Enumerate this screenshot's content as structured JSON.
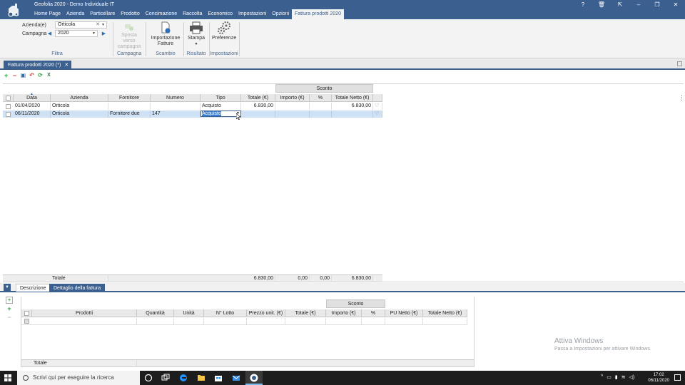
{
  "app": {
    "title": "Geofolia 2020 - Demo Individuale IT"
  },
  "menu": [
    "Home Page",
    "Azienda",
    "Particellare",
    "Prodotto",
    "Concimazione",
    "Raccolta",
    "Economico",
    "Impostazioni",
    "Opzioni",
    "Fattura prodotti 2020"
  ],
  "ribbon": {
    "azienda_label": "Azienda(e)",
    "azienda_value": "Orticola",
    "campagna_label": "Campagna",
    "campagna_value": "2020",
    "spostamento_label": "Sposta verso campagna",
    "importazione_label": "Importazione Fatture",
    "stampa_label": "Stampa",
    "preferenze_label": "Preferenze",
    "groups": {
      "filtra": "Filtra",
      "campagna": "Campagna",
      "scambio": "Scambio",
      "risultato": "Risultato",
      "impostazioni": "Impostazioni"
    }
  },
  "doc_tab": {
    "label": "Fattura prodotti 2020 (*)"
  },
  "grid": {
    "group_header": "Sconto",
    "columns": [
      "Data",
      "Azienda",
      "Fornitore",
      "Numero",
      "Tipo",
      "Totale (€)",
      "Importo (€)",
      "%",
      "Totale Netto (€)"
    ],
    "rows": [
      {
        "data": "01/04/2020",
        "azienda": "Orticola",
        "fornitore": "",
        "numero": "",
        "tipo": "Acquisto",
        "totale": "6.830,00",
        "importo": "",
        "perc": "",
        "netto": "6.830,00"
      },
      {
        "data": "06/11/2020",
        "azienda": "Orticola",
        "fornitore": "Fornitore due",
        "numero": "147",
        "tipo": "Acquisto",
        "totale": "",
        "importo": "",
        "perc": "",
        "netto": ""
      }
    ],
    "totals": {
      "label": "Totale",
      "totale": "6.830,00",
      "importo": "0,00",
      "perc": "0,00",
      "netto": "6.830,00"
    }
  },
  "subtabs": [
    "Descrizione",
    "Dettaglio della fattura"
  ],
  "detail_grid": {
    "group_header": "Sconto",
    "columns": [
      "Prodotti",
      "Quantità",
      "Unità",
      "N° Lotto",
      "Prezzo unit. (€)",
      "Totale (€)",
      "Importo (€)",
      "%",
      "PU Netto (€)",
      "Totale Netto (€)"
    ],
    "total_label": "Totale"
  },
  "watermark": {
    "title": "Attiva Windows",
    "subtitle": "Passa a Impostazioni per attivare Windows."
  },
  "taskbar": {
    "search_placeholder": "Scrivi qui per eseguire la ricerca",
    "time": "17:02",
    "date": "06/11/2020"
  },
  "colors": {
    "titlebar": "#3b5f8f",
    "selected_row": "#cfe2f5",
    "accent": "#2c6fb6"
  }
}
